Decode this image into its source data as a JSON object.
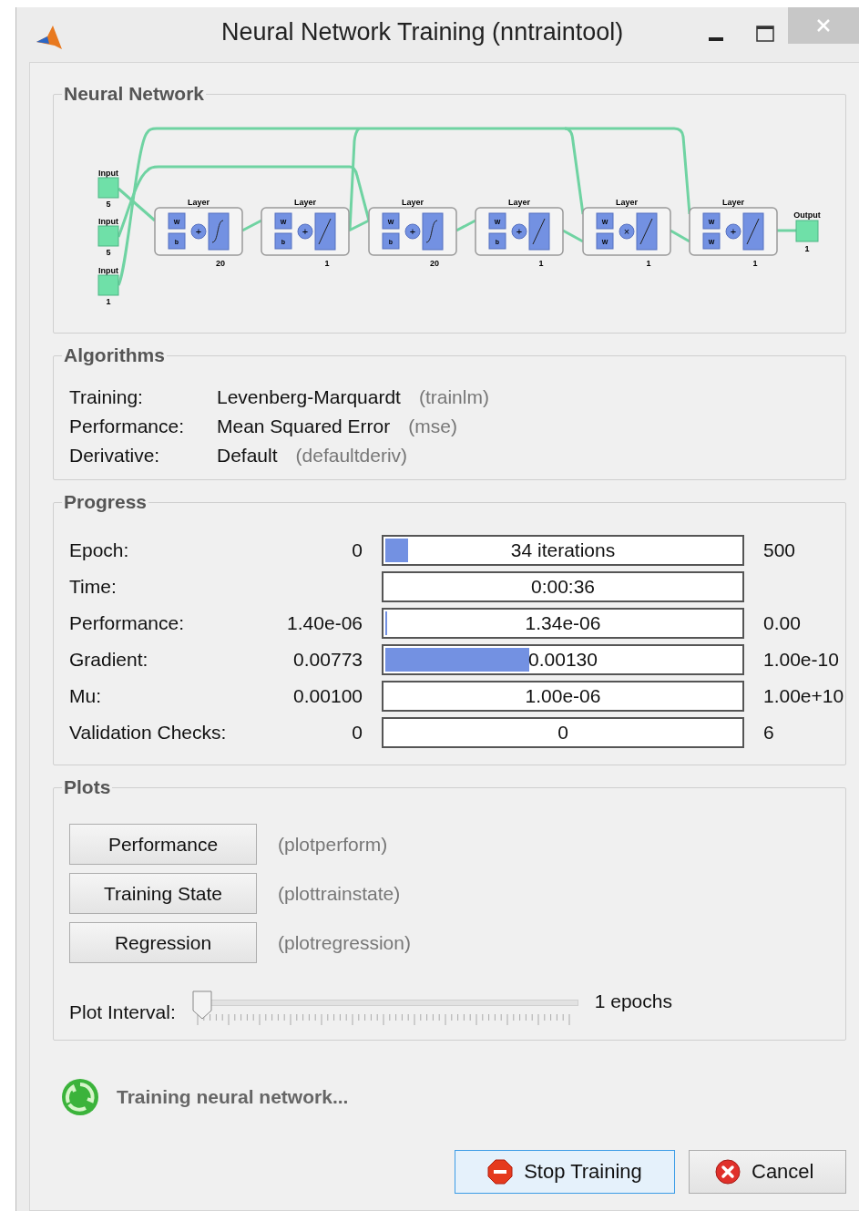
{
  "window": {
    "title": "Neural Network Training (nntraintool)"
  },
  "network": {
    "title": "Neural Network",
    "inputs": [
      {
        "label": "Input",
        "size": "5"
      },
      {
        "label": "Input",
        "size": "5"
      },
      {
        "label": "Input",
        "size": "1"
      }
    ],
    "layers": [
      {
        "label": "Layer",
        "weights": [
          "W",
          "b"
        ],
        "operator": "+",
        "kind": "sigmoid",
        "size": "20"
      },
      {
        "label": "Layer",
        "weights": [
          "W",
          "b"
        ],
        "operator": "+",
        "kind": "linear",
        "size": "1"
      },
      {
        "label": "Layer",
        "weights": [
          "W",
          "b"
        ],
        "operator": "+",
        "kind": "sigmoid",
        "size": "20"
      },
      {
        "label": "Layer",
        "weights": [
          "W",
          "b"
        ],
        "operator": "+",
        "kind": "linear",
        "size": "1"
      },
      {
        "label": "Layer",
        "weights": [
          "W",
          "W"
        ],
        "operator": "×",
        "kind": "linear",
        "size": "1"
      },
      {
        "label": "Layer",
        "weights": [
          "W",
          "W"
        ],
        "operator": "+",
        "kind": "linear",
        "size": "1"
      }
    ],
    "output": {
      "label": "Output",
      "size": "1"
    }
  },
  "algorithms": {
    "title": "Algorithms",
    "rows": [
      {
        "label": "Training:",
        "value": "Levenberg-Marquardt",
        "code": "(trainlm)"
      },
      {
        "label": "Performance:",
        "value": "Mean Squared Error",
        "code": "(mse)"
      },
      {
        "label": "Derivative:",
        "value": "Default",
        "code": "(defaultderiv)"
      }
    ]
  },
  "progress": {
    "title": "Progress",
    "rows": [
      {
        "label": "Epoch:",
        "start": "0",
        "value": "34 iterations",
        "level": 0.068,
        "end": "500"
      },
      {
        "label": "Time:",
        "value": "0:00:36"
      },
      {
        "label": "Performance:",
        "start": "1.40e-06",
        "value": "1.34e-06",
        "level": 0.01,
        "end": "0.00"
      },
      {
        "label": "Gradient:",
        "start": "0.00773",
        "value": "0.00130",
        "level": 0.405,
        "end": "1.00e-10"
      },
      {
        "label": "Mu:",
        "start": "0.00100",
        "value": "1.00e-06",
        "end": "1.00e+10"
      },
      {
        "label": "Validation Checks:",
        "start": "0",
        "value": "0",
        "end": "6"
      }
    ]
  },
  "plots": {
    "title": "Plots",
    "buttons": [
      {
        "label": "Performance",
        "code": "(plotperform)"
      },
      {
        "label": "Training State",
        "code": "(plottrainstate)"
      },
      {
        "label": "Regression",
        "code": "(plotregression)"
      }
    ],
    "interval": {
      "label": "Plot Interval:",
      "level": 0,
      "reading": "1 epochs"
    }
  },
  "status": "Training neural network...",
  "buttons": [
    {
      "label": "Stop Training",
      "kind": "stop",
      "selected": true
    },
    {
      "label": "Cancel",
      "kind": "cancel",
      "selected": false
    }
  ]
}
